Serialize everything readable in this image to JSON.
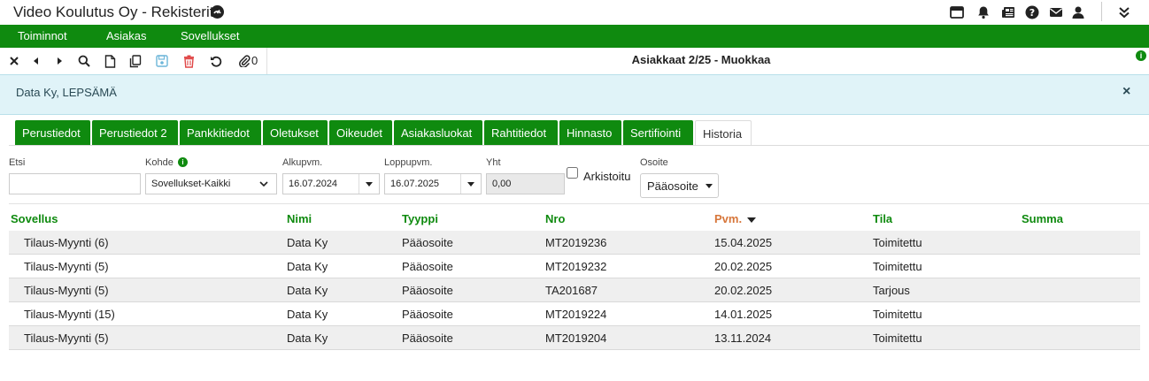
{
  "window": {
    "title": "Video Koulutus Oy - Rekisterit"
  },
  "topbar_icons": [
    "window-icon",
    "bell-icon",
    "newspaper-icon",
    "help-icon",
    "mail-icon",
    "user-icon",
    "double-chevron-down-icon"
  ],
  "menu": {
    "items": [
      "Toiminnot",
      "Asiakas",
      "Sovellukset"
    ]
  },
  "toolbar": {
    "attachments_count": "0",
    "form_title": "Asiakkaat 2/25 - Muokkaa"
  },
  "alert": {
    "text": "Data Ky, LEPSÄMÄ",
    "close": "×"
  },
  "tabs": [
    "Perustiedot",
    "Perustiedot 2",
    "Pankkitiedot",
    "Oletukset",
    "Oikeudet",
    "Asiakasluokat",
    "Rahtitiedot",
    "Hinnasto",
    "Sertifiointi",
    "Historia"
  ],
  "active_tab": "Historia",
  "filters": {
    "search_label": "Etsi",
    "search_value": "",
    "target_label": "Kohde",
    "target_value": "Sovellukset-Kaikki",
    "start_label": "Alkupvm.",
    "start_value": "16.07.2024",
    "end_label": "Loppupvm.",
    "end_value": "16.07.2025",
    "total_label": "Yht",
    "total_value": "0,00",
    "archived_label": "Arkistoitu",
    "address_label": "Osoite",
    "address_value": "Pääosoite"
  },
  "table": {
    "columns": [
      "Sovellus",
      "Nimi",
      "Tyyppi",
      "Nro",
      "Pvm.",
      "Tila",
      "Summa"
    ],
    "sorted_column": "Pvm.",
    "rows": [
      [
        "Tilaus-Myynti (6)",
        "Data Ky",
        "Pääosoite",
        "MT2019236",
        "15.04.2025",
        "Toimitettu",
        ""
      ],
      [
        "Tilaus-Myynti (5)",
        "Data Ky",
        "Pääosoite",
        "MT2019232",
        "20.02.2025",
        "Toimitettu",
        ""
      ],
      [
        "Tilaus-Myynti (5)",
        "Data Ky",
        "Pääosoite",
        "TA201687",
        "20.02.2025",
        "Tarjous",
        ""
      ],
      [
        "Tilaus-Myynti (15)",
        "Data Ky",
        "Pääosoite",
        "MT2019224",
        "14.01.2025",
        "Toimitettu",
        ""
      ],
      [
        "Tilaus-Myynti (5)",
        "Data Ky",
        "Pääosoite",
        "MT2019204",
        "13.11.2024",
        "Toimitettu",
        ""
      ]
    ]
  },
  "colors": {
    "brand_green": "#0f8a0f",
    "sorted_header": "#d7763a",
    "alert_bg": "#e0f3f8",
    "delete_red": "#e04646",
    "save_blue": "#6db6d9"
  }
}
